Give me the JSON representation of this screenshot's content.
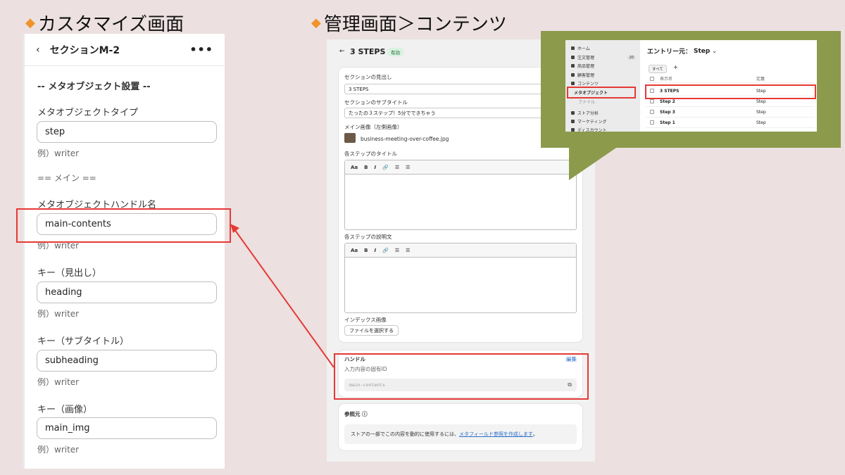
{
  "headings": {
    "left": "カスタマイズ画面",
    "right": "管理画面＞コンテンツ",
    "marker": "◆"
  },
  "colors": {
    "accent_red": "#e53935",
    "popup_bg": "#8c9a4c",
    "diamond": "#f0932b"
  },
  "left_panel": {
    "back_icon": "‹",
    "title": "セクションM-2",
    "more_icon": "•••",
    "section_header": "-- メタオブジェクト設置 --",
    "fields": [
      {
        "label": "メタオブジェクトタイプ",
        "value": "step",
        "hint": "例）writer"
      },
      {
        "label": "メタオブジェクトハンドル名",
        "value": "main-contents",
        "hint": "例）writer"
      },
      {
        "label": "キー（見出し）",
        "value": "heading",
        "hint": "例）writer"
      },
      {
        "label": "キー（サブタイトル）",
        "value": "subheading",
        "hint": "例）writer"
      },
      {
        "label": "キー（画像）",
        "value": "main_img",
        "hint": "例）writer"
      }
    ],
    "divider_text": "== メイン =="
  },
  "mid_panel": {
    "back_icon": "←",
    "title": "3 STEPS",
    "status_badge": "有効",
    "section_heading_label": "セクションの見出し",
    "section_heading_value": "3 STEPS",
    "subtitle_label": "セクションのサブタイトル",
    "subtitle_value": "たったの３ステップ！5分でできちゃう",
    "main_image_label": "メイン画像（左側画像）",
    "main_image_file": "business-meeting-over-coffee.jpg",
    "step_title_label": "各ステップのタイトル",
    "step_desc_label": "各ステップの説明文",
    "toolbar": {
      "text_style": "Aa",
      "bold": "B",
      "italic": "I",
      "link": "🔗",
      "ul": "☰",
      "ol": "☰"
    },
    "index_image_label": "インデックス画像",
    "choose_file_button": "ファイルを選択する",
    "handle_label": "ハンドル",
    "handle_edit": "編集",
    "handle_help": "入力内容の固有ID",
    "handle_value": "main-contents",
    "copy_icon": "⧉",
    "ref_label": "参照元",
    "info_icon": "ⓘ",
    "ref_text": "ストアの一部でこの内容を動的に使用するには、",
    "ref_link": "メタフィールド参照を作成します",
    "ref_end": "。"
  },
  "admin_popup": {
    "nav": [
      {
        "label": "ホーム",
        "badge": ""
      },
      {
        "label": "注文管理",
        "badge": "20"
      },
      {
        "label": "商品管理",
        "badge": ""
      },
      {
        "label": "顧客管理",
        "badge": ""
      },
      {
        "label": "コンテンツ",
        "badge": ""
      },
      {
        "label": "メタオブジェクト",
        "badge": ""
      },
      {
        "label": "ファイル",
        "badge": ""
      },
      {
        "label": "ストア分析",
        "badge": ""
      },
      {
        "label": "マーケティング",
        "badge": ""
      },
      {
        "label": "ディスカウント",
        "badge": ""
      }
    ],
    "title": "エントリー元：",
    "title_type": "Step",
    "dropdown_icon": "⌄",
    "tab_all": "すべて",
    "add_tab": "+",
    "col_name": "表示名",
    "col_def": "定義",
    "rows": [
      {
        "name": "3 STEPS",
        "def": "Step"
      },
      {
        "name": "Step 2",
        "def": "Step"
      },
      {
        "name": "Step 3",
        "def": "Step"
      },
      {
        "name": "Step 1",
        "def": "Step"
      }
    ]
  }
}
